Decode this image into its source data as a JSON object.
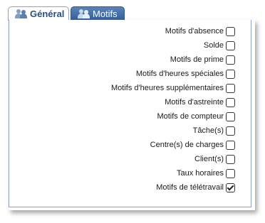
{
  "tabs": [
    {
      "label": "Général",
      "active": false,
      "icon": "users-icon"
    },
    {
      "label": "Motifs",
      "active": true,
      "icon": "users-icon"
    }
  ],
  "motifs": [
    {
      "label": "Motifs d'absence",
      "checked": false
    },
    {
      "label": "Solde",
      "checked": false
    },
    {
      "label": "Motifs de prime",
      "checked": false
    },
    {
      "label": "Motifs d'heures spéciales",
      "checked": false
    },
    {
      "label": "Motifs d'heures supplémentaires",
      "checked": false
    },
    {
      "label": "Motifs d'astreinte",
      "checked": false
    },
    {
      "label": "Motifs de compteur",
      "checked": false
    },
    {
      "label": "Tâche(s)",
      "checked": false
    },
    {
      "label": "Centre(s) de charges",
      "checked": false
    },
    {
      "label": "Client(s)",
      "checked": false
    },
    {
      "label": "Taux horaires",
      "checked": false
    },
    {
      "label": "Motifs de télétravail",
      "checked": true
    }
  ],
  "colors": {
    "tab_active_bg": "#33609b",
    "tab_border": "#8aa4c6",
    "tab_inactive_text": "#2b4f83"
  }
}
